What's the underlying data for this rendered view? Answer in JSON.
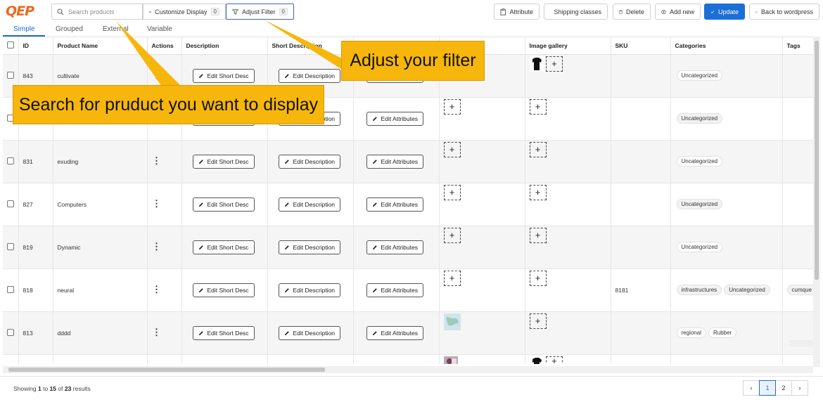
{
  "toolbar": {
    "logo": "QEP",
    "search_placeholder": "Search products",
    "customize_label": "Customize Display",
    "customize_count": "0",
    "filter_label": "Adjust Filter",
    "filter_count": "0",
    "attribute_label": "Attribute",
    "shipping_label": "Shipping classes",
    "delete_label": "Delete",
    "add_new_label": "Add new",
    "update_label": "Update",
    "back_label": "Back to wordpress",
    "accent_color": "#1b6fd8"
  },
  "tabs": [
    {
      "label": "Simple",
      "active": true
    },
    {
      "label": "Grouped",
      "active": false
    },
    {
      "label": "External",
      "active": false
    },
    {
      "label": "Variable",
      "active": false
    }
  ],
  "table": {
    "headers": [
      "ID",
      "Product Name",
      "Actions",
      "Description",
      "Short Description",
      "",
      "",
      "Image gallery",
      "SKU",
      "Categories",
      "Tags"
    ],
    "short_desc_btn": "Edit Short Desc",
    "desc_btn": "Edit Description",
    "attr_btn": "Edit Attributes",
    "rows": [
      {
        "id": "843",
        "name": "cultivate",
        "sku": "",
        "categories": [
          "Uncategorized"
        ],
        "tags": ""
      },
      {
        "id": "",
        "name": "",
        "sku": "",
        "categories": [
          "Uncategorized"
        ],
        "tags": ""
      },
      {
        "id": "831",
        "name": "exuding",
        "sku": "",
        "categories": [
          "Uncategorized"
        ],
        "tags": ""
      },
      {
        "id": "827",
        "name": "Computers",
        "sku": "",
        "categories": [
          "Uncategorized"
        ],
        "tags": ""
      },
      {
        "id": "819",
        "name": "Dynamic",
        "sku": "",
        "categories": [
          "Uncategorized"
        ],
        "tags": ""
      },
      {
        "id": "818",
        "name": "neural",
        "sku": "8181",
        "categories": [
          "infrastructures",
          "Uncategorized"
        ],
        "tags": "cumque"
      },
      {
        "id": "813",
        "name": "dddd",
        "sku": "",
        "categories": [
          "regional",
          "Rubber"
        ],
        "tags": ""
      }
    ]
  },
  "footer": {
    "showing_prefix": "Showing",
    "from": "1",
    "to_word": "to",
    "to": "15",
    "of_word": "of",
    "total": "23",
    "results_word": "results",
    "pages": [
      "1",
      "2"
    ],
    "current_page": "1"
  },
  "callouts": {
    "search": "Search for pruduct you want to display",
    "filter": "Adjust your filter",
    "color": "#f6b60c"
  }
}
